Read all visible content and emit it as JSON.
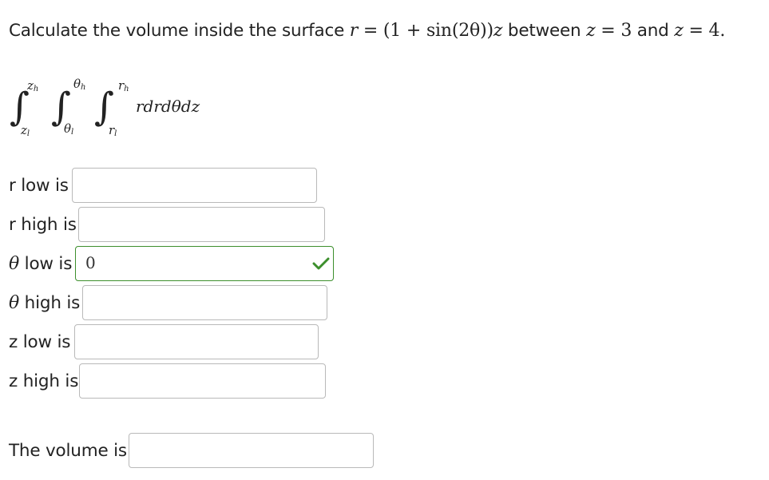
{
  "question": {
    "prefix": "Calculate the volume inside the surface",
    "r_var": "r",
    "equals": " = ",
    "expr_open": "(1 + ",
    "sin": "sin",
    "sin_arg": "(2θ)",
    "expr_close": ")",
    "z_var": "z",
    "between": " between ",
    "z_eq_1": "z",
    "z_val_1": "3",
    "and": " and ",
    "z_eq_2": "z",
    "z_val_2": "4",
    "period": "."
  },
  "integral": {
    "outer_upper": "z",
    "outer_upper_sub": "h",
    "outer_lower": "z",
    "outer_lower_sub": "l",
    "middle_upper": "θ",
    "middle_upper_sub": "h",
    "middle_lower": "θ",
    "middle_lower_sub": "l",
    "inner_upper": "r",
    "inner_upper_sub": "h",
    "inner_lower": "r",
    "inner_lower_sub": "l",
    "sign": "∫",
    "integrand": "rdrdθdz"
  },
  "fields": {
    "r_low": {
      "label_pre": "r",
      "label_post": " low is",
      "value": ""
    },
    "r_high": {
      "label_pre": "r",
      "label_post": " high is",
      "value": ""
    },
    "theta_low": {
      "label_pre": "θ",
      "label_post": " low is",
      "value": "0",
      "status": "correct"
    },
    "theta_high": {
      "label_pre": "θ",
      "label_post": " high is",
      "value": ""
    },
    "z_low": {
      "label_pre": "z",
      "label_post": " low is",
      "value": ""
    },
    "z_high": {
      "label_pre": "z",
      "label_post": " high is",
      "value": ""
    },
    "volume": {
      "label": "The volume is",
      "value": ""
    }
  },
  "icons": {
    "check": "check-icon"
  },
  "colors": {
    "text": "#222222",
    "box_border": "#b9b9b9",
    "correct_border": "#3c8f2c",
    "check": "#3c8f2c"
  }
}
